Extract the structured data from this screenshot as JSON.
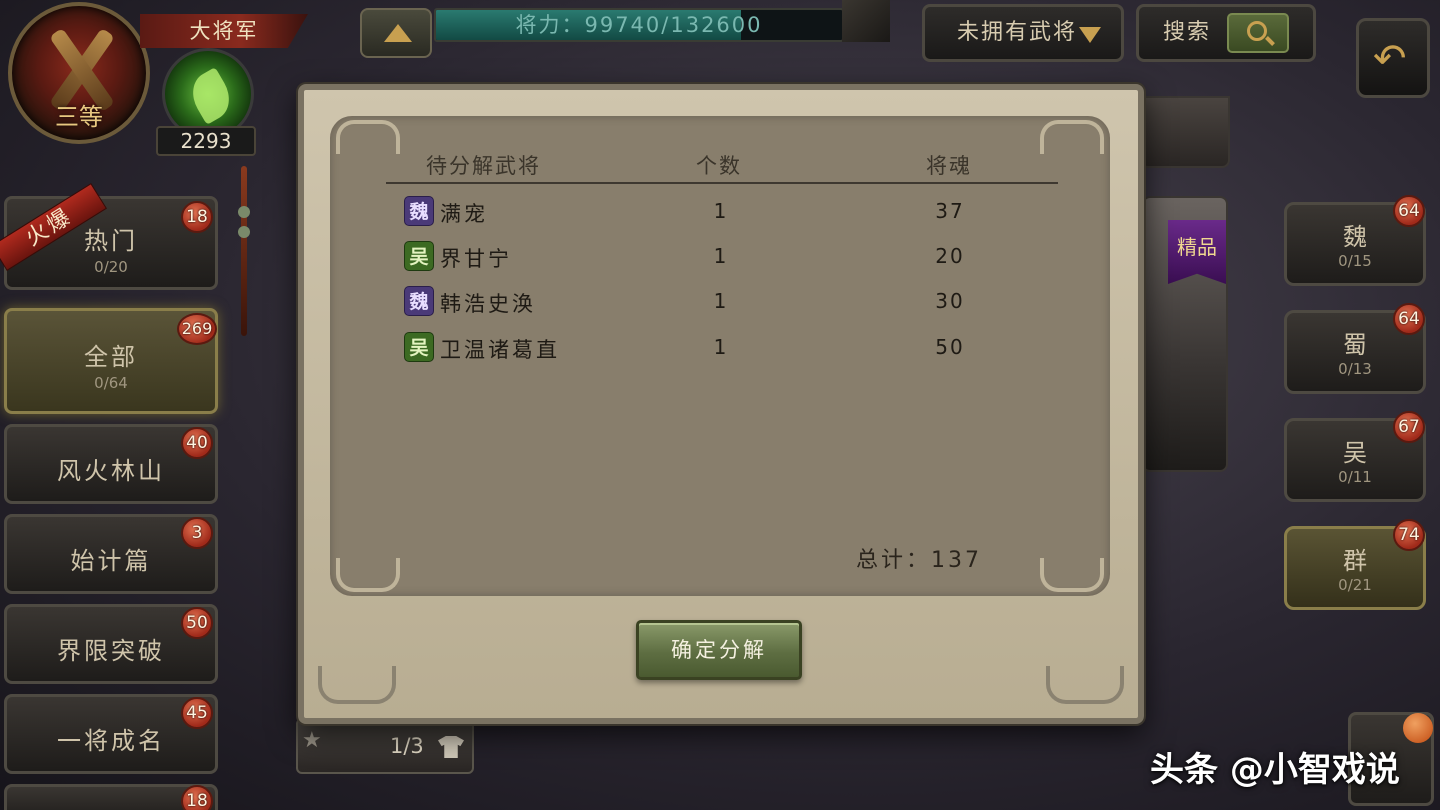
{
  "header": {
    "rank_title": "大将军",
    "rank_level": "三等",
    "orb_count": "2293",
    "power_text": "将力：99740/132600",
    "power_fraction": 0.752,
    "filter_dropdown": "未拥有武将",
    "search_label": "搜索"
  },
  "categories": [
    {
      "name": "热门",
      "sub": "0/20",
      "badge": "18"
    },
    {
      "name": "全部",
      "sub": "0/64",
      "badge": "269"
    },
    {
      "name": "风火林山",
      "badge": "40"
    },
    {
      "name": "始计篇",
      "badge": "3"
    },
    {
      "name": "界限突破",
      "badge": "50"
    },
    {
      "name": "一将成名",
      "badge": "45"
    },
    {
      "name": "",
      "badge": "18"
    }
  ],
  "hot_ribbon": "火爆",
  "factions": [
    {
      "name": "魏",
      "sub": "0/15",
      "badge": "64"
    },
    {
      "name": "蜀",
      "sub": "0/13",
      "badge": "64"
    },
    {
      "name": "吴",
      "sub": "0/11",
      "badge": "67"
    },
    {
      "name": "群",
      "sub": "0/21",
      "badge": "74"
    }
  ],
  "quality_tag": "精品",
  "card_strip": {
    "count": "1/3"
  },
  "dialog": {
    "col_hero": "待分解武将",
    "col_count": "个数",
    "col_soul": "将魂",
    "rows": [
      {
        "faction": "魏",
        "name": "满宠",
        "count": "1",
        "soul": "37",
        "chip": "wei"
      },
      {
        "faction": "吴",
        "name": "界甘宁",
        "count": "1",
        "soul": "20",
        "chip": "wu"
      },
      {
        "faction": "魏",
        "name": "韩浩史涣",
        "count": "1",
        "soul": "30",
        "chip": "wei"
      },
      {
        "faction": "吴",
        "name": "卫温诸葛直",
        "count": "1",
        "soul": "50",
        "chip": "wu"
      }
    ],
    "total": "总计：137",
    "confirm": "确定分解"
  },
  "watermark": "头条 @小智戏说"
}
